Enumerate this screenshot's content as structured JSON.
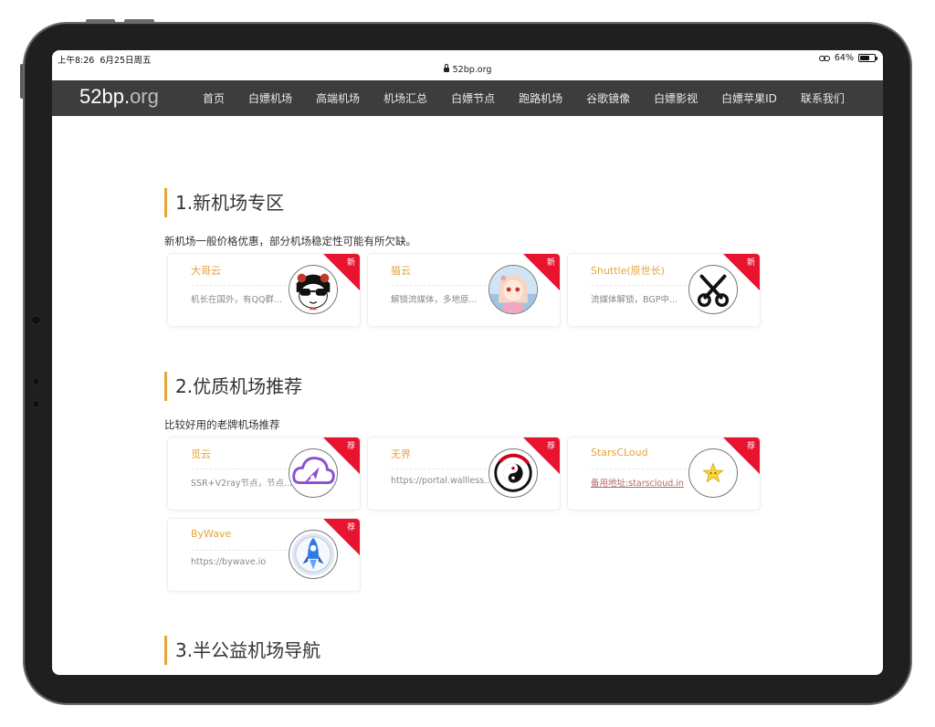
{
  "status": {
    "time": "上午8:26",
    "date": "6月25日周五",
    "battery": "64%",
    "battery_level": 0.64
  },
  "browser": {
    "url": "52bp.org"
  },
  "nav": {
    "brand": "52bp.",
    "brand_tld": "org",
    "items": [
      "首页",
      "白嫖机场",
      "高端机场",
      "机场汇总",
      "白嫖节点",
      "跑路机场",
      "谷歌镜像",
      "白嫖影视",
      "白嫖苹果ID",
      "联系我们"
    ]
  },
  "sections": [
    {
      "title": "1.新机场专区",
      "desc": "新机场一般价格优惠，部分机场稳定性可能有所欠缺。",
      "cards": [
        {
          "name": "大哥云",
          "desc": "机长在国外，有QQ群...",
          "badge": "新",
          "icon": "sunglasses-girl-avatar"
        },
        {
          "name": "猫云",
          "desc": "解锁流媒体，多地原...",
          "badge": "新",
          "icon": "anime-girl-avatar"
        },
        {
          "name": "Shuttle(原世长)",
          "desc": "流媒体解锁，BGP中...",
          "badge": "新",
          "icon": "scissors-avatar"
        }
      ]
    },
    {
      "title": "2.优质机场推荐",
      "desc": "比较好用的老牌机场推荐",
      "cards": [
        {
          "name": "觅云",
          "desc": "SSR+V2ray节点，节点...",
          "badge": "荐",
          "icon": "cloud-plane-avatar"
        },
        {
          "name": "无界",
          "desc": "https://portal.wallless.xyz/",
          "badge": "荐",
          "icon": "yinyang-avatar"
        },
        {
          "name": "StarsCLoud",
          "desc": "备用地址:starscloud.in",
          "badge": "荐",
          "icon": "star-avatar"
        },
        {
          "name": "ByWave",
          "desc": "https://bywave.io",
          "badge": "荐",
          "icon": "rocket-avatar"
        }
      ]
    },
    {
      "title": "3.半公益机场导航"
    }
  ],
  "colors": {
    "accent": "#e8a33a",
    "ribbon": "#e8132e",
    "navbar": "#3d3d3d"
  }
}
